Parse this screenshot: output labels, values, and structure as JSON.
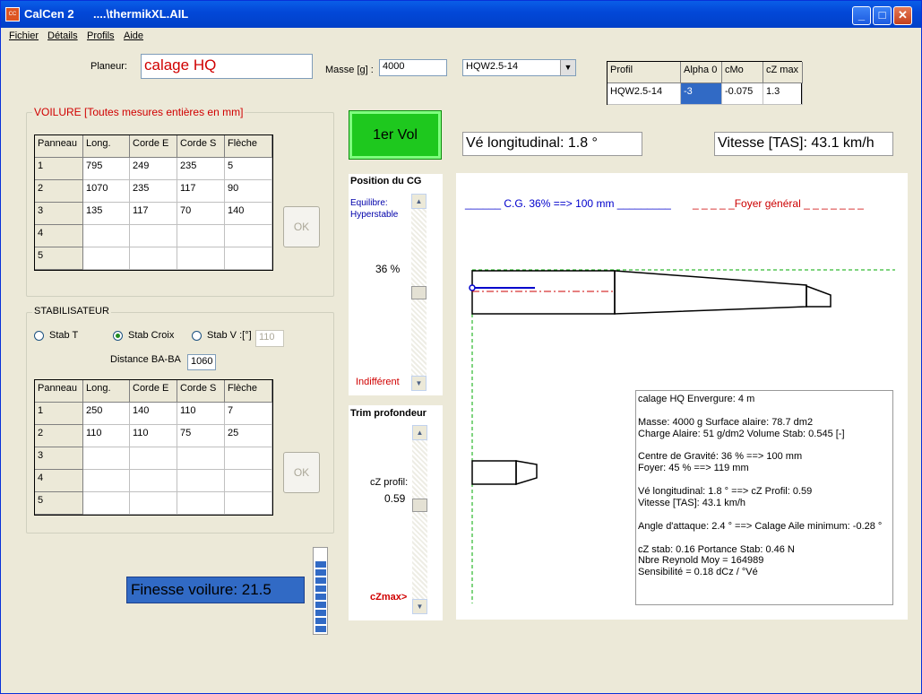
{
  "window": {
    "app_name": "CalCen 2",
    "file_name": "....\\thermikXL.AIL",
    "minimize_label": "_",
    "maximize_label": "□",
    "close_label": "✕",
    "icon_name": "calcen-app-icon",
    "app_icon_text": "CC"
  },
  "menu": {
    "items": [
      "Fichier",
      "Détails",
      "Profils",
      "Aide"
    ]
  },
  "top": {
    "planeur_label": "Planeur:",
    "planeur_value": "calage HQ",
    "masse_label": "Masse [g] :",
    "masse_value": "4000",
    "profile_select": "HQW2.5-14",
    "dropdown_icon": "▼",
    "profile_table": {
      "headers": [
        "Profil",
        "Alpha 0",
        "cMo",
        "cZ max"
      ],
      "row": [
        "HQW2.5-14",
        "-3",
        "-0.075",
        "1.3"
      ]
    }
  },
  "first_flight_button": "1er Vol",
  "ve_long": "Vé longitudinal: 1.8 °",
  "vitesse": "Vitesse [TAS]: 43.1 km/h",
  "voilure": {
    "title": "VOILURE  [Toutes mesures entières en mm]",
    "headers": [
      "Panneau",
      "Long.",
      "Corde E",
      "Corde S",
      "Flèche"
    ],
    "rows": [
      [
        "1",
        "795",
        "249",
        "235",
        "5"
      ],
      [
        "2",
        "1070",
        "235",
        "117",
        "90"
      ],
      [
        "3",
        "135",
        "117",
        "70",
        "140"
      ],
      [
        "4",
        "",
        "",
        "",
        ""
      ],
      [
        "5",
        "",
        "",
        "",
        ""
      ]
    ],
    "ok_label": "OK"
  },
  "stab": {
    "title": "STABILISATEUR",
    "radio_t": "Stab T",
    "radio_croix": "Stab Croix",
    "radio_v": "Stab V :[°]",
    "v_angle": "110",
    "selected_radio": "Stab Croix",
    "distance_label": "Distance BA-BA",
    "distance_value": "1060",
    "headers": [
      "Panneau",
      "Long.",
      "Corde E",
      "Corde S",
      "Flèche"
    ],
    "rows": [
      [
        "1",
        "250",
        "140",
        "110",
        "7"
      ],
      [
        "2",
        "110",
        "110",
        "75",
        "25"
      ],
      [
        "3",
        "",
        "",
        "",
        ""
      ],
      [
        "4",
        "",
        "",
        "",
        ""
      ],
      [
        "5",
        "",
        "",
        "",
        ""
      ]
    ],
    "ok_label": "OK"
  },
  "finesse": "Finesse voilure: 21.5",
  "finesse_level": 0.9,
  "cg_panel": {
    "title": "Position du CG",
    "status1": "Equilibre:",
    "status2": "Hyperstable",
    "percent": "36 %",
    "bottom": "Indifférent",
    "slider_fraction": 0.5,
    "scroll_up_icon": "▲",
    "scroll_down_icon": "▼"
  },
  "trim_panel": {
    "title": "Trim profondeur",
    "cz_label": "cZ profil:",
    "cz_value": "0.59",
    "bottom": "cZmax>",
    "slider_fraction": 0.4
  },
  "diagram": {
    "cg_legend": "______ C.G. 36% ==> 100 mm _________",
    "foyer_legend": "_ _ _ _ _Foyer général _ _ _ _ _ _ _",
    "colors": {
      "cg": "#0000cc",
      "foyer": "#cc0000",
      "ref_line": "#00aa00"
    }
  },
  "summary": {
    "lines": [
      "calage HQ      Envergure: 4 m",
      "",
      "Masse: 4000 g  Surface alaire: 78.7 dm2",
      "Charge Alaire: 51 g/dm2  Volume Stab: 0.545 [-]",
      "",
      "Centre de Gravité: 36 %  ==> 100 mm",
      "Foyer: 45 %  ==> 119 mm",
      "",
      "Vé longitudinal: 1.8 ° ==> cZ Profil: 0.59",
      "Vitesse [TAS]: 43.1 km/h",
      "",
      "Angle d'attaque: 2.4 ° ==> Calage Aile minimum: -0.28 °",
      "",
      "cZ stab: 0.16   Portance Stab: 0.46 N",
      "Nbre Reynold Moy = 164989",
      "Sensibilité = 0.18 dCz / °Vé"
    ]
  }
}
